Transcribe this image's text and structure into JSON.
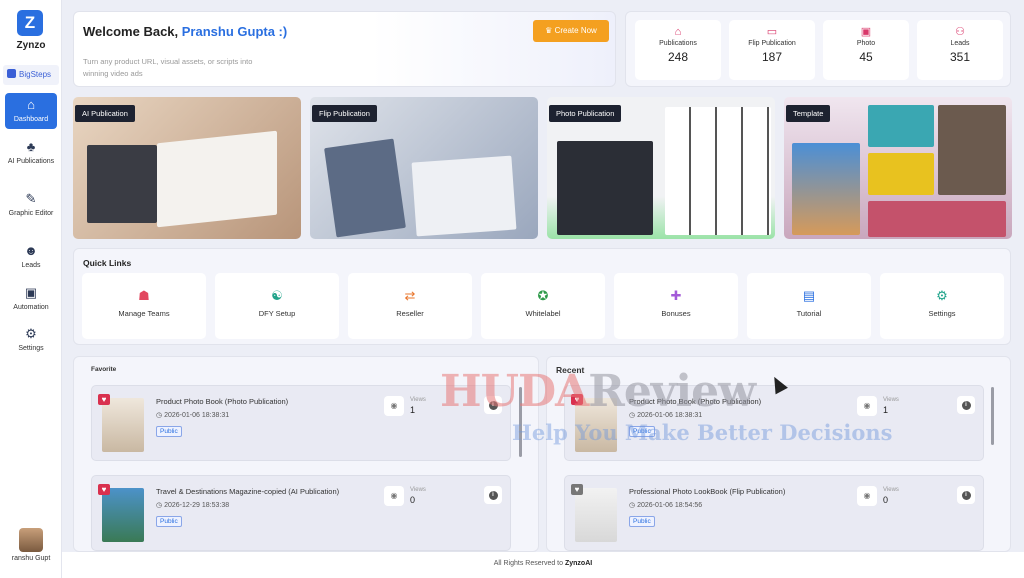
{
  "app": {
    "logo_text": "Zynzo",
    "logo_mark": "Z",
    "workspace": "BigSteps"
  },
  "nav": [
    {
      "label": "Dashboard",
      "icon": "home-icon",
      "glyph": "⌂",
      "active": true
    },
    {
      "label": "AI Publications",
      "icon": "ai-icon",
      "glyph": "♣"
    },
    {
      "label": "Graphic Editor",
      "icon": "edit-icon",
      "glyph": "✎"
    },
    {
      "label": "Leads",
      "icon": "leads-icon",
      "glyph": "☻"
    },
    {
      "label": "Automation",
      "icon": "automation-icon",
      "glyph": "▣"
    },
    {
      "label": "Settings",
      "icon": "gear-icon",
      "glyph": "⚙"
    }
  ],
  "user": {
    "name": "ranshu Gupt"
  },
  "welcome": {
    "greeting": "Welcome Back,",
    "name": "Pranshu Gupta :)",
    "subtitle": "Turn any product URL, visual assets, or scripts into winning video ads",
    "create_label": "Create Now"
  },
  "stats": [
    {
      "label": "Publications",
      "value": "248",
      "glyph": "⌂"
    },
    {
      "label": "Flip Publication",
      "value": "187",
      "glyph": "▭"
    },
    {
      "label": "Photo",
      "value": "45",
      "glyph": "▣"
    },
    {
      "label": "Leads",
      "value": "351",
      "glyph": "⚇"
    }
  ],
  "features": [
    {
      "tag": "AI Publication"
    },
    {
      "tag": "Flip Publication"
    },
    {
      "tag": "Photo Publication"
    },
    {
      "tag": "Template"
    }
  ],
  "quick_links": {
    "title": "Quick Links",
    "items": [
      {
        "label": "Manage Teams",
        "glyph": "☗",
        "color": "#e2475f"
      },
      {
        "label": "DFY Setup",
        "glyph": "☯",
        "color": "#1fa38a"
      },
      {
        "label": "Reseller",
        "glyph": "⇄",
        "color": "#e8742a"
      },
      {
        "label": "Whitelabel",
        "glyph": "✪",
        "color": "#2f9a4a"
      },
      {
        "label": "Bonuses",
        "glyph": "✚",
        "color": "#a35ad8"
      },
      {
        "label": "Tutorial",
        "glyph": "▤",
        "color": "#2a6fe0"
      },
      {
        "label": "Settings",
        "glyph": "⚙",
        "color": "#1fa38a"
      }
    ]
  },
  "favorite": {
    "title": "Favorite",
    "rows": [
      {
        "title": "Product Photo Book (Photo Publication)",
        "date": "2026-01-06 18:38:31",
        "badge": "Public",
        "views_label": "Views",
        "views": "1"
      },
      {
        "title": "Travel & Destinations Magazine-copied (AI Publication)",
        "date": "2026-12-29 18:53:38",
        "badge": "Public",
        "views_label": "Views",
        "views": "0"
      }
    ]
  },
  "recent": {
    "title": "Recent",
    "rows": [
      {
        "title": "Product Photo Book (Photo Publication)",
        "date": "2026-01-06 18:38:31",
        "badge": "Public",
        "views_label": "Views",
        "views": "1"
      },
      {
        "title": "Professional Photo LookBook (Flip Publication)",
        "date": "2026-01-06 18:54:56",
        "badge": "Public",
        "views_label": "Views",
        "views": "0"
      }
    ]
  },
  "footer": {
    "text": "All Rights Reserved to",
    "brand": "ZynzoAI"
  },
  "watermark": {
    "line1a": "HUDA",
    "line1b": "Review",
    "line2": "Help You Make Better Decisions"
  }
}
